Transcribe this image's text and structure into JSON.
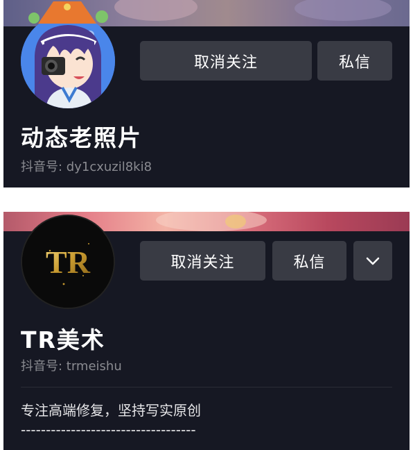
{
  "profiles": [
    {
      "name": "动态老照片",
      "douyin_id": "抖音号: dy1cxuzil8ki8",
      "buttons": {
        "unfollow": "取消关注",
        "message": "私信"
      },
      "avatar_icon": "anime-girl-avatar-icon"
    },
    {
      "name": "TR美术",
      "douyin_id": "抖音号: trmeishu",
      "buttons": {
        "unfollow": "取消关注",
        "message": "私信"
      },
      "avatar_text": "TR",
      "bio_lines": [
        "专注高端修复，坚持写实原创",
        "-----------------------------------"
      ]
    }
  ],
  "colors": {
    "card_bg": "#161823",
    "button_bg": "#393b44",
    "secondary_text": "#8a8b91"
  }
}
